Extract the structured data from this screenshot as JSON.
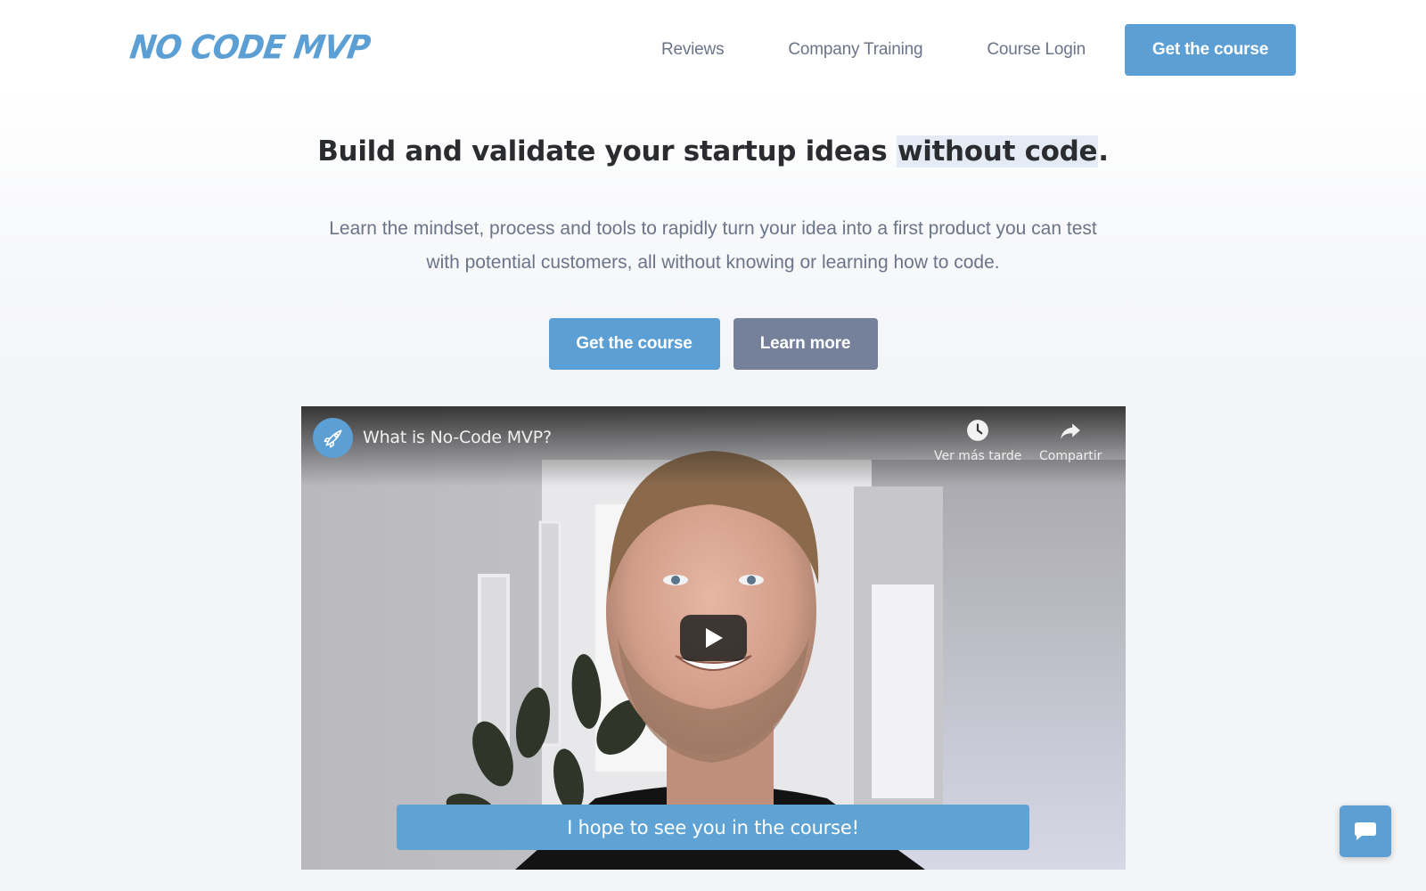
{
  "header": {
    "logo_text": "No Code MVP",
    "nav": [
      {
        "label": "Reviews"
      },
      {
        "label": "Company Training"
      },
      {
        "label": "Course Login"
      }
    ],
    "cta_label": "Get the course"
  },
  "hero": {
    "title_main": "Build and validate your startup ideas ",
    "title_highlight": "without code",
    "title_end": ".",
    "subtitle_line1": "Learn the mindset, process and tools to rapidly turn your idea into a first product you can test",
    "subtitle_line2": "with potential customers, all without knowing or learning how to code.",
    "primary_button": "Get the course",
    "secondary_button": "Learn more"
  },
  "video": {
    "title": "What is No-Code MVP?",
    "channel_icon": "rocket-icon",
    "actions": [
      {
        "icon": "clock-icon",
        "label": "Ver más tarde"
      },
      {
        "icon": "share-icon",
        "label": "Compartir"
      }
    ],
    "caption": "I hope to see you in the course!"
  },
  "chat": {
    "icon": "chat-bubble-icon"
  },
  "colors": {
    "brand_blue": "#5b9fd4",
    "secondary_gray": "#75819b",
    "nav_text": "#6b7489",
    "heading_text": "#2b2c2f",
    "highlight_bg": "#e4ebf5"
  }
}
